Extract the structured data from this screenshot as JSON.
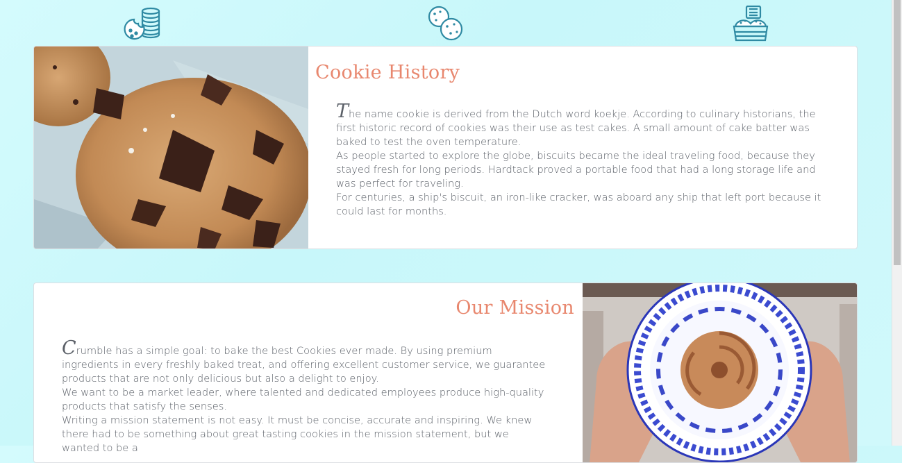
{
  "icons": [
    {
      "name": "cookie-stack-icon"
    },
    {
      "name": "cookies-icon"
    },
    {
      "name": "cookie-box-icon"
    }
  ],
  "history": {
    "title": "Cookie History",
    "dropcap": "T",
    "p1": "he name cookie is derived from the Dutch word koekje. According to culinary historians, the first historic record of cookies was their use as test cakes. A small amount of cake batter was baked to test the oven temperature.",
    "p2": "As people started to explore the globe, biscuits became the ideal traveling food, because they stayed fresh for long periods. Hardtack proved a portable food that had a long storage life and was perfect for traveling.",
    "p3": "For centuries, a ship's biscuit, an iron-like cracker, was aboard any ship that left port because it could last for months."
  },
  "mission": {
    "title": "Our Mission",
    "dropcap": "C",
    "p1": "rumble has a simple goal: to bake the best Cookies ever made. By using premium ingredients in every freshly baked treat, and offering excellent customer service, we guarantee products that are not only delicious but also a delight to enjoy.",
    "p2": "We want to be a market leader, where talented and dedicated employees produce high-quality products that satisfy the senses.",
    "p3": "Writing a mission statement is not easy. It must be concise, accurate and inspiring. We knew there had to be something about great tasting cookies in the mission statement, but we wanted to be a"
  },
  "colors": {
    "accent": "#e8876e",
    "icon": "#2f8aa3",
    "background": "#d2fafc"
  }
}
